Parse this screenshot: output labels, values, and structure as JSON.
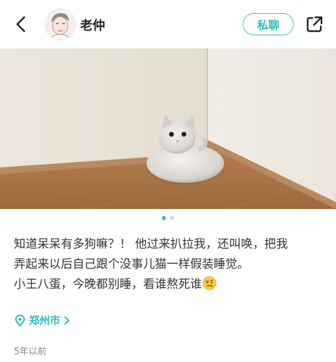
{
  "header": {
    "username": "老仲",
    "message_button": "私聊"
  },
  "icons": {
    "back": "chevron-left-icon",
    "share": "share-external-icon",
    "location": "location-pin-icon",
    "emoji": "smirk-emoji"
  },
  "carousel": {
    "pages": 2,
    "active_index": 0,
    "accent": "#2fc3c7"
  },
  "post": {
    "lines": [
      "知道呆呆有多狗嘛？！ 他过来扒拉我，还叫唤，把我",
      "弄起来以后自己跟个没事儿猫一样假装睡觉。",
      "小王八蛋，今晚都别睡，看谁熬死谁"
    ]
  },
  "location": "郑州市",
  "timestamp": "5年以前",
  "colors": {
    "accent": "#2bbcbc"
  }
}
